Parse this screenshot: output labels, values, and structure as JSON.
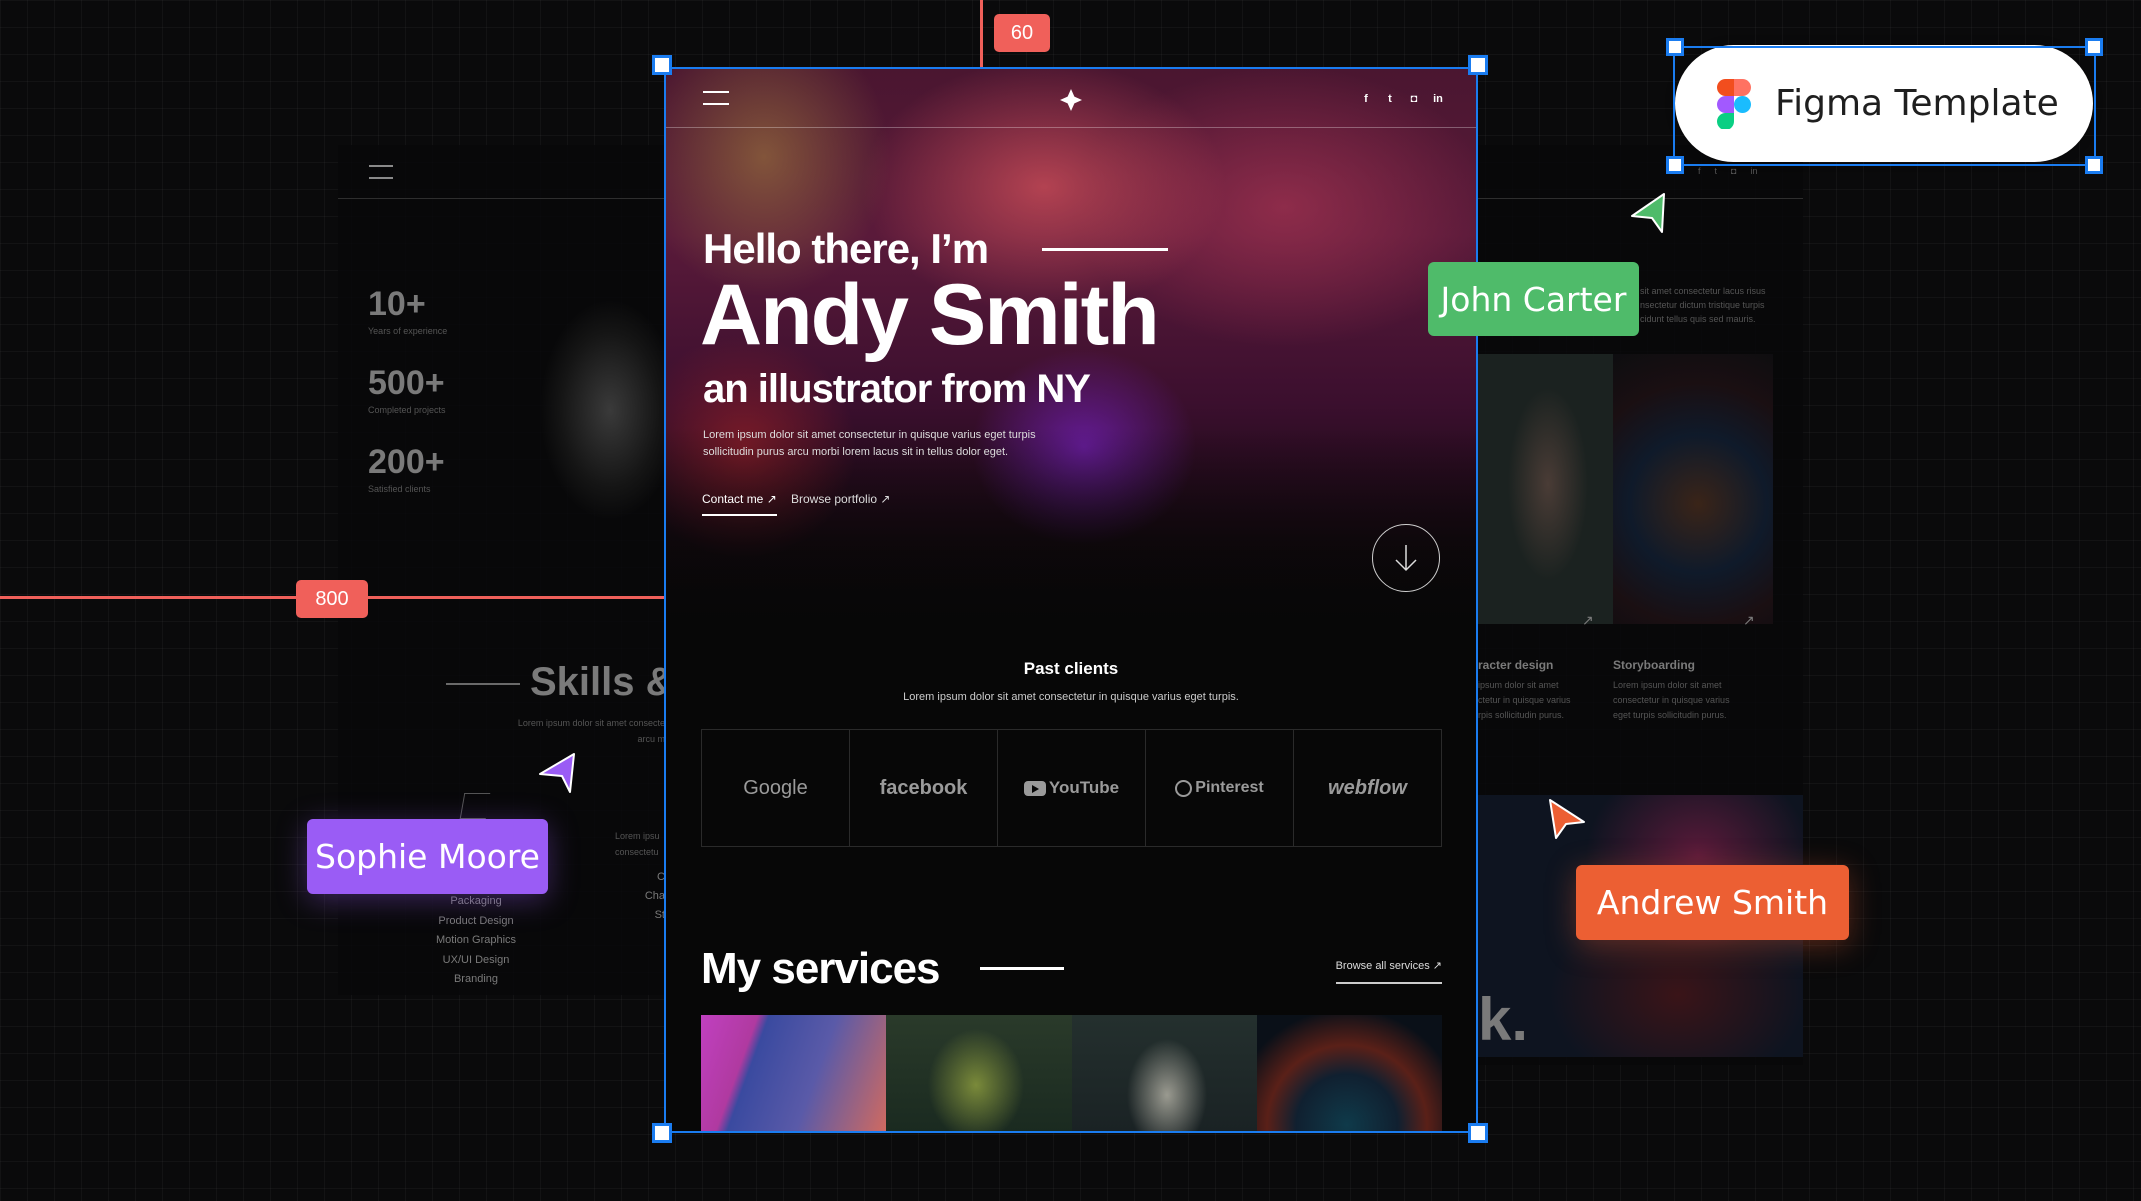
{
  "rulers": {
    "top_value": "60",
    "left_value": "800"
  },
  "figma_badge": {
    "label": "Figma Template",
    "colors": [
      "#f24e1e",
      "#ff7262",
      "#a259ff",
      "#1abcfe",
      "#0acf83"
    ]
  },
  "collaborators": [
    {
      "name": "John Carter",
      "color": "#4fbb6a"
    },
    {
      "name": "Sophie Moore",
      "color": "#9a5cf5"
    },
    {
      "name": "Andrew Smith",
      "color": "#ec5f33"
    }
  ],
  "left_page": {
    "stats": [
      {
        "value": "10+",
        "label": "Years of experience"
      },
      {
        "value": "500+",
        "label": "Completed projects"
      },
      {
        "value": "200+",
        "label": "Satisfied clients"
      }
    ],
    "skills_title": "Skills &",
    "skills_desc_line1": "Lorem ipsum dolor sit amet consecte",
    "skills_desc_line2": "arcu m",
    "skills_list": [
      "Packaging",
      "Product Design",
      "Motion Graphics",
      "UX/UI Design",
      "Branding"
    ],
    "col2_desc1": "Lorem ipsu",
    "col2_desc2": "consectetu",
    "col2_items": [
      "C",
      "Cha",
      "St"
    ]
  },
  "right_page": {
    "about_lines": [
      "sit amet consectetur lacus risus",
      "nsectetur dictum tristique turpis",
      "cidunt tellus quis sed mauris."
    ],
    "services": [
      {
        "title": "racter design",
        "desc": [
          "ipsum dolor sit amet",
          "ctetur in quisque varius",
          "rpis sollicitudin purus."
        ]
      },
      {
        "title": "Storyboarding",
        "desc": [
          "Lorem ipsum dolor sit amet",
          "consectetur in quisque varius",
          "eget turpis sollicitudin purus."
        ]
      }
    ],
    "big_letter": "k."
  },
  "nav": {
    "socials": [
      "f",
      "t",
      "ig",
      "in"
    ]
  },
  "hero": {
    "hello": "Hello there, I’m",
    "name": "Andy Smith",
    "subtitle": "an illustrator from NY",
    "description": "Lorem ipsum dolor sit amet consectetur in quisque varius eget turpis sollicitudin purus arcu morbi lorem lacus sit in tellus dolor eget.",
    "contact_label": "Contact me ↗",
    "browse_label": "Browse portfolio ↗"
  },
  "clients": {
    "title": "Past clients",
    "description": "Lorem ipsum dolor sit amet consectetur in quisque varius eget turpis.",
    "logos": [
      "Google",
      "facebook",
      "YouTube",
      "Pinterest",
      "webflow"
    ]
  },
  "services": {
    "title": "My services",
    "browse_label": "Browse all services ↗"
  }
}
